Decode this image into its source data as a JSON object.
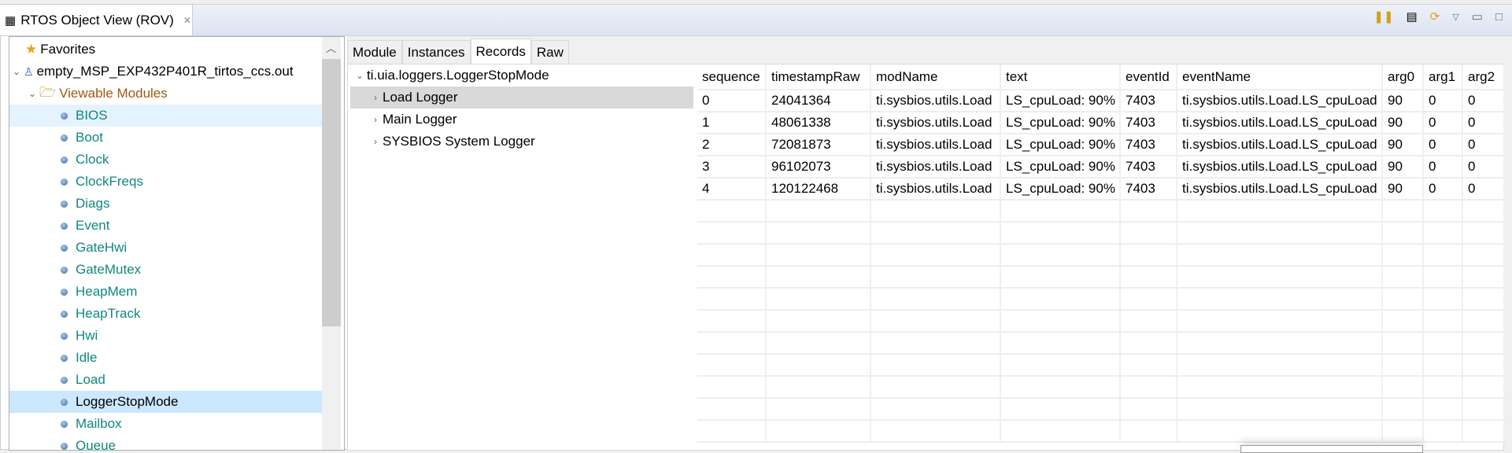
{
  "view": {
    "title": "RTOS Object View (ROV)"
  },
  "toolbar": [
    "pause-icon",
    "resize-columns-icon",
    "refresh-icon",
    "view-menu-icon",
    "minimize-icon",
    "maximize-icon"
  ],
  "tree": {
    "favorites": "Favorites",
    "program": "empty_MSP_EXP432P401R_tirtos_ccs.out",
    "viewable": "Viewable Modules",
    "modules": [
      "BIOS",
      "Boot",
      "Clock",
      "ClockFreqs",
      "Diags",
      "Event",
      "GateHwi",
      "GateMutex",
      "HeapMem",
      "HeapTrack",
      "Hwi",
      "Idle",
      "Load",
      "LoggerStopMode",
      "Mailbox",
      "Queue"
    ],
    "selected": "LoggerStopMode",
    "hovered": "BIOS"
  },
  "tabs": [
    "Module",
    "Instances",
    "Records",
    "Raw"
  ],
  "active_tab": "Records",
  "instances": {
    "root": "ti.uia.loggers.LoggerStopMode",
    "children": [
      "Load Logger",
      "Main Logger",
      "SYSBIOS System Logger"
    ]
  },
  "table": {
    "columns": [
      "sequence",
      "timestampRaw",
      "modName",
      "text",
      "eventId",
      "eventName",
      "arg0",
      "arg1",
      "arg2"
    ],
    "rows": [
      [
        "0",
        "24041364",
        "ti.sysbios.utils.Load",
        "LS_cpuLoad: 90%",
        "7403",
        "ti.sysbios.utils.Load.LS_cpuLoad",
        "90",
        "0",
        "0"
      ],
      [
        "1",
        "48061338",
        "ti.sysbios.utils.Load",
        "LS_cpuLoad: 90%",
        "7403",
        "ti.sysbios.utils.Load.LS_cpuLoad",
        "90",
        "0",
        "0"
      ],
      [
        "2",
        "72081873",
        "ti.sysbios.utils.Load",
        "LS_cpuLoad: 90%",
        "7403",
        "ti.sysbios.utils.Load.LS_cpuLoad",
        "90",
        "0",
        "0"
      ],
      [
        "3",
        "96102073",
        "ti.sysbios.utils.Load",
        "LS_cpuLoad: 90%",
        "7403",
        "ti.sysbios.utils.Load.LS_cpuLoad",
        "90",
        "0",
        "0"
      ],
      [
        "4",
        "120122468",
        "ti.sysbios.utils.Load",
        "LS_cpuLoad: 90%",
        "7403",
        "ti.sysbios.utils.Load.LS_cpuLoad",
        "90",
        "0",
        "0"
      ]
    ]
  }
}
